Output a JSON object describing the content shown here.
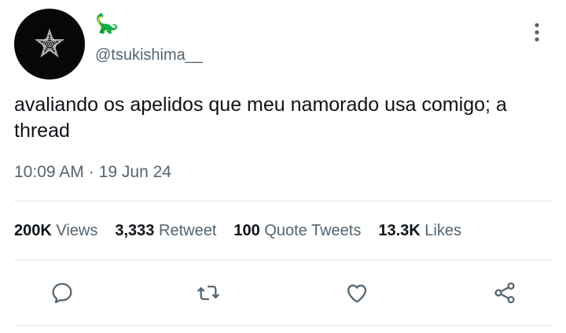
{
  "author": {
    "display_name": "🦕",
    "handle": "@tsukishima__",
    "avatar_icon": "spiral-star-avatar"
  },
  "tweet": {
    "text": "avaliando os apelidos que meu namorado usa comigo; a thread",
    "time": "10:09 AM",
    "separator": "·",
    "date": "19 Jun 24"
  },
  "stats": {
    "views_count": "200K",
    "views_label": "Views",
    "retweets_count": "3,333",
    "retweets_label": "Retweet",
    "quotes_count": "100",
    "quotes_label": "Quote Tweets",
    "likes_count": "13.3K",
    "likes_label": "Likes"
  },
  "actions": {
    "reply_icon": "reply-icon",
    "retweet_icon": "retweet-icon",
    "like_icon": "heart-icon",
    "share_icon": "share-icon",
    "icon_color": "#536471"
  }
}
